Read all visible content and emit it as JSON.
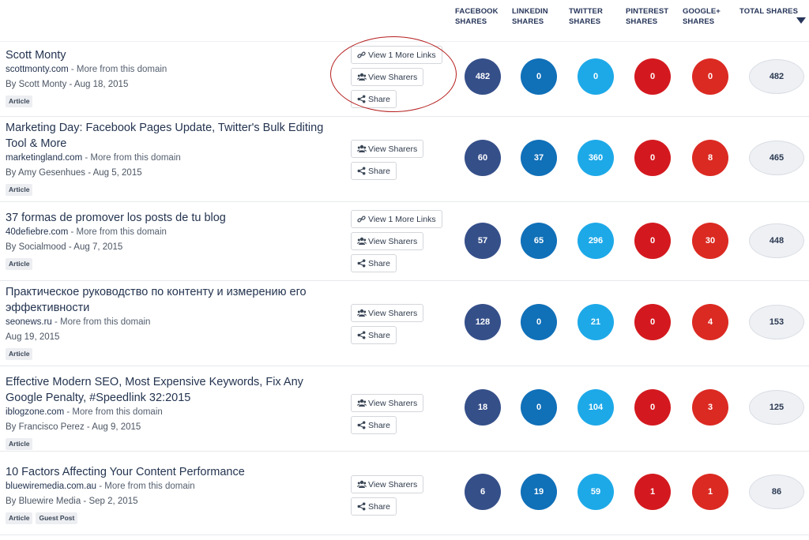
{
  "columns": {
    "facebook": [
      "FACEBOOK",
      "SHARES"
    ],
    "linkedin": [
      "LINKEDIN",
      "SHARES"
    ],
    "twitter": [
      "TWITTER",
      "SHARES"
    ],
    "pinterest": [
      "PINTEREST",
      "SHARES"
    ],
    "googleplus": [
      "GOOGLE+",
      "SHARES"
    ],
    "total": [
      "TOTAL SHARES"
    ]
  },
  "buttons": {
    "view_more": "View 1 More Links",
    "view_sharers": "View Sharers",
    "share": "Share"
  },
  "colors": {
    "facebook": "#354f89",
    "linkedin": "#1070b8",
    "twitter": "#1da9e8",
    "pinterest": "#d3191f",
    "googleplus": "#db2a22",
    "highlight": "#b51d1d"
  },
  "rows": [
    {
      "title": "Scott Monty",
      "domain": "scottmonty.com",
      "more": " - More from this domain",
      "byline": "By Scott Monty - Aug 18, 2015",
      "tags": [
        "Article"
      ],
      "has_more_links": true,
      "facebook": "482",
      "linkedin": "0",
      "twitter": "0",
      "pinterest": "0",
      "googleplus": "0",
      "total": "482"
    },
    {
      "title": "Marketing Day: Facebook Pages Update, Twitter's Bulk Editing Tool & More",
      "domain": "marketingland.com",
      "more": " - More from this domain",
      "byline": "By Amy Gesenhues - Aug 5, 2015",
      "tags": [
        "Article"
      ],
      "has_more_links": false,
      "facebook": "60",
      "linkedin": "37",
      "twitter": "360",
      "pinterest": "0",
      "googleplus": "8",
      "total": "465"
    },
    {
      "title": "37 formas de promover los posts de tu blog",
      "domain": "40defiebre.com",
      "more": " - More from this domain",
      "byline": "By Socialmood - Aug 7, 2015",
      "tags": [
        "Article"
      ],
      "has_more_links": true,
      "facebook": "57",
      "linkedin": "65",
      "twitter": "296",
      "pinterest": "0",
      "googleplus": "30",
      "total": "448"
    },
    {
      "title": "Практическое руководство по контенту и измерению его эффективности",
      "domain": "seonews.ru",
      "more": " - More from this domain",
      "byline": "Aug 19, 2015",
      "tags": [
        "Article"
      ],
      "has_more_links": false,
      "facebook": "128",
      "linkedin": "0",
      "twitter": "21",
      "pinterest": "0",
      "googleplus": "4",
      "total": "153"
    },
    {
      "title": "Effective Modern SEO, Most Expensive Keywords, Fix Any Google Penalty, #Speedlink 32:2015",
      "domain": "iblogzone.com",
      "more": " - More from this domain",
      "byline": "By Francisco Perez - Aug 9, 2015",
      "tags": [
        "Article"
      ],
      "has_more_links": false,
      "facebook": "18",
      "linkedin": "0",
      "twitter": "104",
      "pinterest": "0",
      "googleplus": "3",
      "total": "125"
    },
    {
      "title": "10 Factors Affecting Your Content Performance",
      "domain": "bluewiremedia.com.au",
      "more": " - More from this domain",
      "byline": "By Bluewire Media - Sep 2, 2015",
      "tags": [
        "Article",
        "Guest Post"
      ],
      "has_more_links": false,
      "facebook": "6",
      "linkedin": "19",
      "twitter": "59",
      "pinterest": "1",
      "googleplus": "1",
      "total": "86"
    }
  ]
}
